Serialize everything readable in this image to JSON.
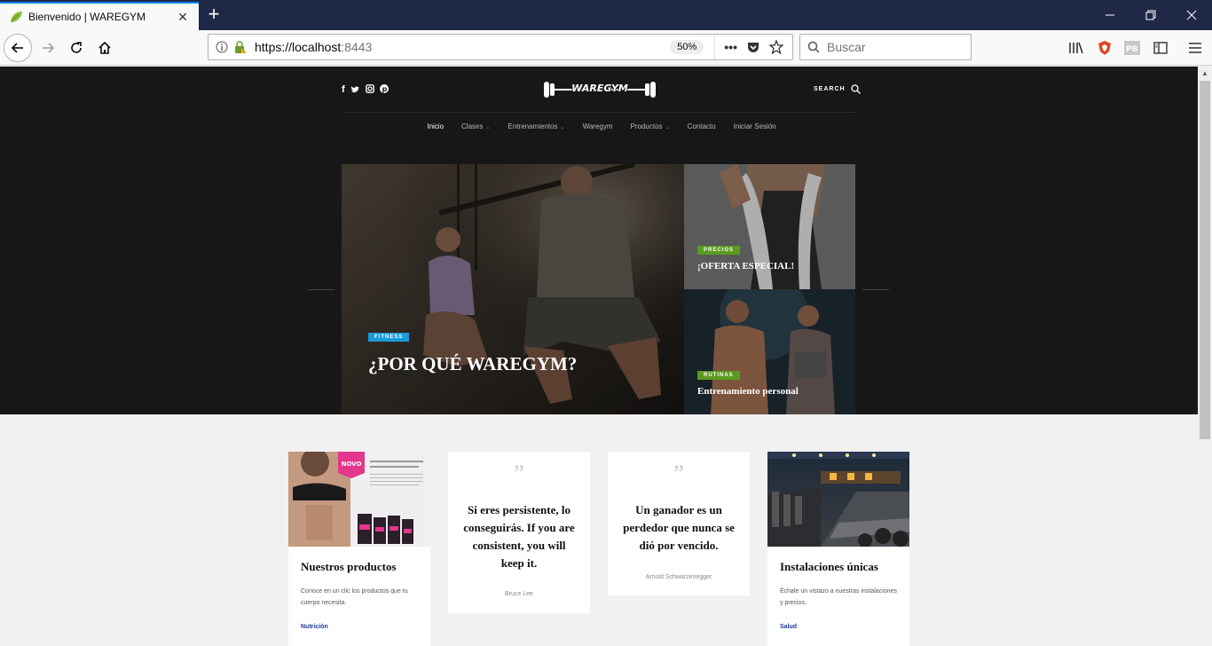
{
  "browser": {
    "tab_title": "Bienvenido | WAREGYM",
    "url_host": "https://localhost",
    "url_port": ":8443",
    "zoom": "50%",
    "search_placeholder": "Buscar"
  },
  "site": {
    "search_label": "SEARCH",
    "nav": [
      {
        "label": "Inicio",
        "active": true,
        "dropdown": false
      },
      {
        "label": "Clases",
        "active": false,
        "dropdown": true
      },
      {
        "label": "Entrenamientos",
        "active": false,
        "dropdown": true
      },
      {
        "label": "Waregym",
        "active": false,
        "dropdown": false
      },
      {
        "label": "Productos",
        "active": false,
        "dropdown": true
      },
      {
        "label": "Contacto",
        "active": false,
        "dropdown": false
      },
      {
        "label": "Iniciar Sesión",
        "active": false,
        "dropdown": false
      }
    ],
    "featured": {
      "badge": "FITNESS",
      "title": "¿POR QUÉ WAREGYM?"
    },
    "side_posts": [
      {
        "badge": "PRECIOS",
        "title": "¡OFERTA ESPECIAL!"
      },
      {
        "badge": "RUTINAS",
        "title": "Entrenamiento personal"
      }
    ],
    "cards": {
      "products": {
        "title": "Nuestros productos",
        "desc": "Conoce en un clic los productos que tu cuerpo necesita.",
        "category": "Nutrición",
        "novo": "NOVO"
      },
      "quote1": {
        "text": "Si eres persistente, lo conseguirás. If you are consistent, you will keep it.",
        "author": "Bruce Lee"
      },
      "quote2": {
        "text": "Un ganador es un perdedor que nunca se dió por vencido.",
        "author": "Arnold Schwarzenegger"
      },
      "facilities": {
        "title": "Instalaciones únicas",
        "desc": "Échale un vistazo a nuestras instalaciones y precios.",
        "category": "Salud"
      }
    }
  },
  "colors": {
    "fitness_badge": "#1a9ad6",
    "green_badge": "#5b9a1f",
    "header_bg": "#171717",
    "link_blue": "#1f3a93"
  }
}
